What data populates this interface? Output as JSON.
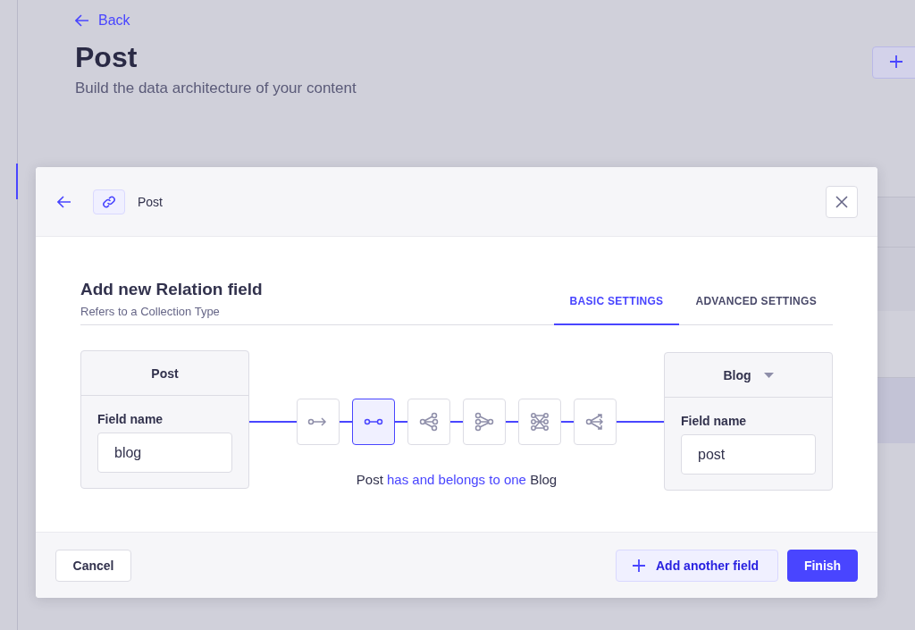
{
  "page": {
    "back_link": "Back",
    "title": "Post",
    "subtitle": "Build the data architecture of your content"
  },
  "modal": {
    "breadcrumb": "Post",
    "heading": "Add new Relation field",
    "subheading": "Refers to a Collection Type",
    "tabs": [
      {
        "label": "BASIC SETTINGS",
        "selected": true
      },
      {
        "label": "ADVANCED SETTINGS",
        "selected": false
      }
    ],
    "left_entity": {
      "name": "Post",
      "field_label": "Field name",
      "field_value": "blog"
    },
    "relations": [
      {
        "kind": "one-way",
        "selected": false
      },
      {
        "kind": "one-to-one",
        "selected": true
      },
      {
        "kind": "one-to-many",
        "selected": false
      },
      {
        "kind": "many-to-one",
        "selected": false
      },
      {
        "kind": "many-to-many",
        "selected": false
      },
      {
        "kind": "many-way",
        "selected": false
      }
    ],
    "description": {
      "source": "Post",
      "relation": "has and belongs to one",
      "target": "Blog"
    },
    "right_entity": {
      "name": "Blog",
      "field_label": "Field name",
      "field_value": "post"
    },
    "footer": {
      "cancel": "Cancel",
      "add_another": "Add another field",
      "finish": "Finish"
    }
  }
}
